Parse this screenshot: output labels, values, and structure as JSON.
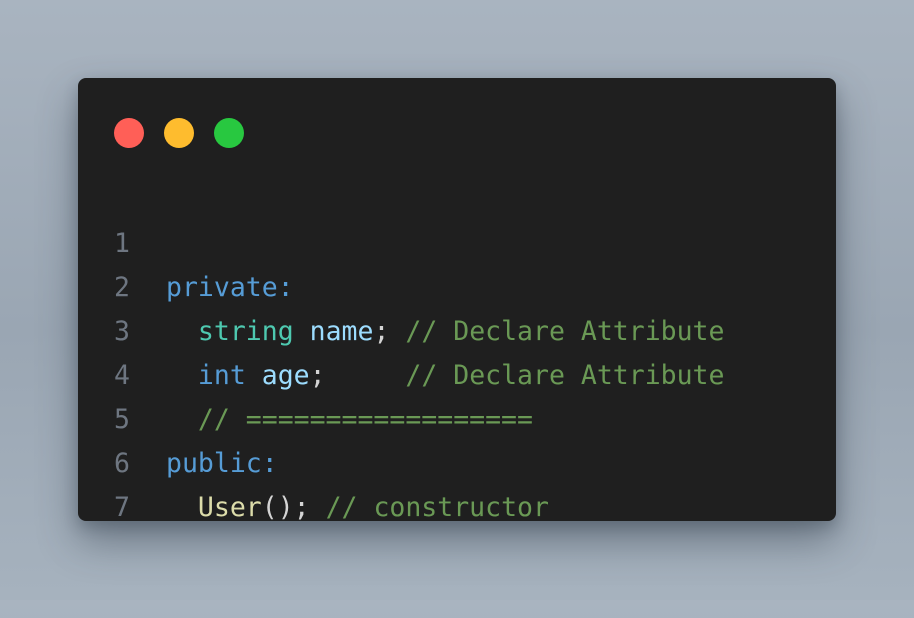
{
  "window": {
    "controls": [
      "close",
      "minimize",
      "maximize"
    ],
    "colors": {
      "close": "#ff5f57",
      "minimize": "#febc2e",
      "maximize": "#28c840",
      "background": "#1f1f1f"
    }
  },
  "code": {
    "lines": [
      {
        "number": "1",
        "tokens": [
          {
            "text": "private:",
            "kind": "keyword"
          }
        ]
      },
      {
        "number": "2",
        "tokens": [
          {
            "text": "  ",
            "kind": "plain"
          },
          {
            "text": "string",
            "kind": "type"
          },
          {
            "text": " ",
            "kind": "plain"
          },
          {
            "text": "name",
            "kind": "variable"
          },
          {
            "text": "; ",
            "kind": "punctuation"
          },
          {
            "text": "// Declare Attribute",
            "kind": "comment"
          }
        ]
      },
      {
        "number": "3",
        "tokens": [
          {
            "text": "  ",
            "kind": "plain"
          },
          {
            "text": "int",
            "kind": "keyword"
          },
          {
            "text": " ",
            "kind": "plain"
          },
          {
            "text": "age",
            "kind": "variable"
          },
          {
            "text": ";     ",
            "kind": "punctuation"
          },
          {
            "text": "// Declare Attribute",
            "kind": "comment"
          }
        ]
      },
      {
        "number": "4",
        "tokens": [
          {
            "text": "  ",
            "kind": "plain"
          },
          {
            "text": "// ==================",
            "kind": "comment"
          }
        ]
      },
      {
        "number": "5",
        "tokens": [
          {
            "text": "public:",
            "kind": "keyword"
          }
        ]
      },
      {
        "number": "6",
        "tokens": [
          {
            "text": "  ",
            "kind": "plain"
          },
          {
            "text": "User",
            "kind": "function"
          },
          {
            "text": "(); ",
            "kind": "punctuation"
          },
          {
            "text": "// constructor",
            "kind": "comment"
          }
        ]
      },
      {
        "number": "7",
        "tokens": []
      }
    ]
  }
}
